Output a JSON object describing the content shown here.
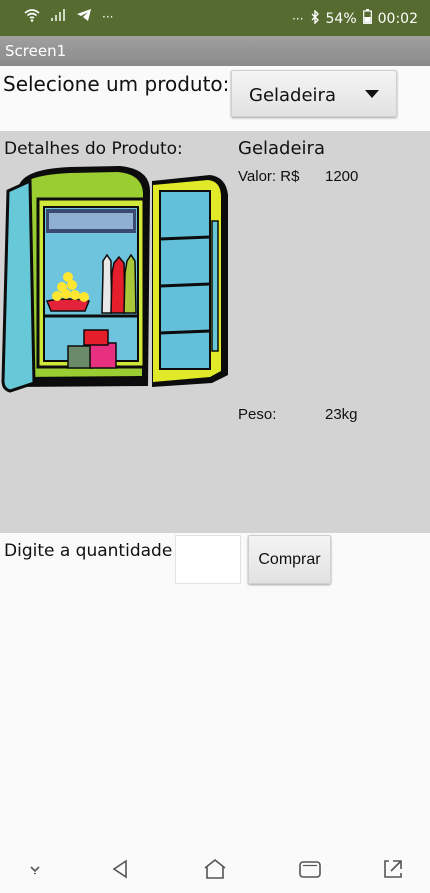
{
  "status_bar": {
    "dots": "···",
    "dots_right": "···",
    "battery_text": "54%",
    "time": "00:02",
    "icons": [
      "wifi-icon",
      "signal-icon",
      "telegram-icon",
      "bluetooth-icon",
      "battery-icon"
    ]
  },
  "title_bar": {
    "title": "Screen1"
  },
  "selector": {
    "label": "Selecione um produto:",
    "selected": "Geladeira"
  },
  "details": {
    "heading": "Detalhes do Produto:",
    "product_name": "Geladeira",
    "price_label": "Valor: R$",
    "price_value": "1200",
    "weight_label": "Peso:",
    "weight_value": "23kg",
    "image": "refrigerator-illustration"
  },
  "purchase": {
    "quantity_label": "Digite a quantidade",
    "quantity_value": "",
    "buy_label": "Comprar"
  },
  "nav_bar": {
    "buttons": [
      "hide-keyboard-icon",
      "back-icon",
      "home-icon",
      "recents-icon",
      "rotate-icon"
    ]
  },
  "colors": {
    "status_bar": "#556b2f",
    "title_bar": "#8a8a8a",
    "panel": "#d3d3d3"
  }
}
